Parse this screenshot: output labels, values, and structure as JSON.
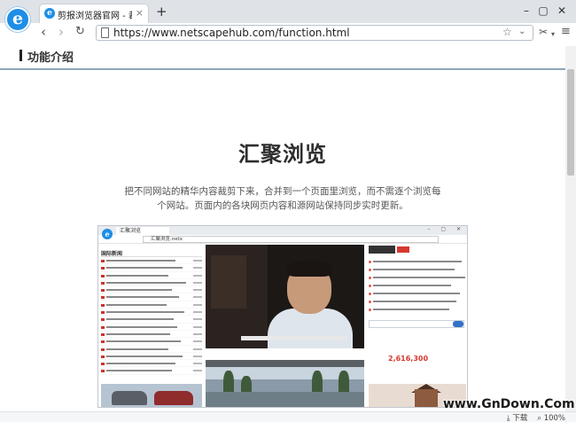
{
  "browser": {
    "tab_title": "剪报浏览器官网 - 裁剪网",
    "tab_close": "×",
    "new_tab": "+",
    "url": "https://www.netscapehub.com/function.html",
    "window_controls": [
      "–",
      "▢",
      "✕"
    ],
    "tools": [
      "scissors-icon",
      "menu-icon"
    ]
  },
  "page": {
    "section_title": "功能介绍",
    "feature_title": "汇聚浏览",
    "feature_desc": "把不同网站的精华内容裁剪下来，合并到一个页面里浏览，而不需逐个浏览每个网站。页面内的各块网页内容和源网站保持同步实时更新。",
    "preview": {
      "tab_title": "汇聚浏览",
      "url": "汇聚浏览.netx",
      "video_caption": "错选 · 播出网_人民日报体育中文网站 总理调人和网上亲民",
      "news_head": "国际新闻",
      "count_value": "2,616,300"
    }
  },
  "status": {
    "download": "下载",
    "zoom": "100%"
  },
  "watermark": "www.GnDown.Com"
}
